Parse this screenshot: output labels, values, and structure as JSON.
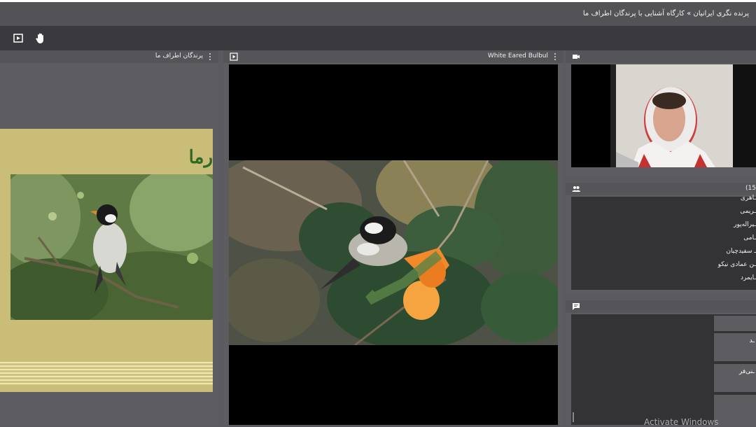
{
  "breadcrumb": {
    "text": "پرنده نگری ایرانیان » کارگاه آشنایی با پرندگان اطراف ما"
  },
  "toolbar": {
    "buttons": [
      {
        "icon": "share-play-icon"
      },
      {
        "icon": "raise-hand-icon"
      }
    ]
  },
  "share_pod": {
    "title": "پرندگان اطراف ما",
    "slide_heading": "رما"
  },
  "video_pod": {
    "title": "White Eared Bulbul",
    "icon": "video-play-icon"
  },
  "camera_pod": {
    "icon": "camera-icon"
  },
  "attendees_pod": {
    "icon": "attendees-icon",
    "count_label": "(15",
    "attendees": [
      "ـاهری",
      "ـریمی",
      "ـیراله‌پور",
      "ـامی",
      "ـ سفیدچیان",
      "ـن عمادی نیکو",
      "ـایمرد"
    ]
  },
  "chat_pod": {
    "icon": "chat-icon",
    "tabs": [
      "",
      "ـد",
      "ـنی‌فر",
      ""
    ]
  },
  "watermark": {
    "text": "Activate Windows"
  },
  "colors": {
    "background": "#5b5b5f",
    "toolbar": "#3a3a3e",
    "slide_background": "#c9bd78",
    "slide_heading": "#2c6a25"
  }
}
